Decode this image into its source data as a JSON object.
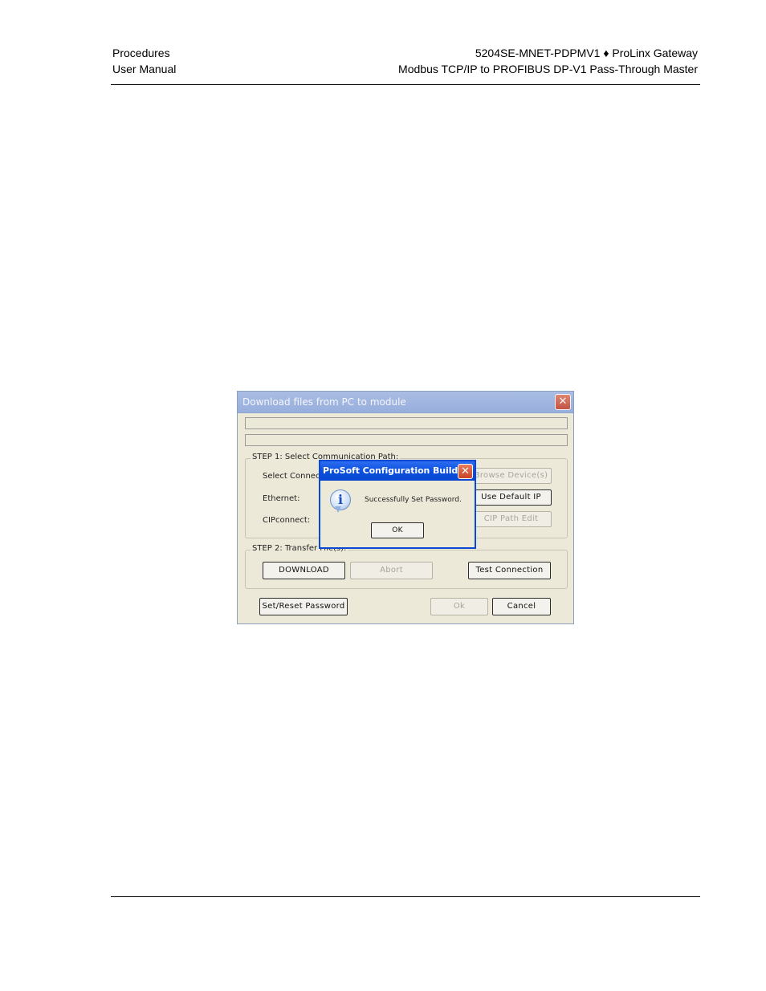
{
  "header": {
    "left_line1": "Procedures",
    "left_line2": "User Manual",
    "right_line1": "5204SE-MNET-PDPMV1 ♦ ProLinx Gateway",
    "right_line2": "Modbus TCP/IP to PROFIBUS DP-V1 Pass-Through Master"
  },
  "download_dialog": {
    "title": "Download files from PC to module",
    "step1_label": "STEP 1: Select Communication Path:",
    "select_connection_label": "Select Connection",
    "ethernet_label": "Ethernet:",
    "cipconnect_label": "CIPconnect:",
    "browse_button": "Browse Device(s)",
    "default_ip_button": "Use Default IP",
    "cip_path_button": "CIP Path Edit",
    "step2_label": "STEP 2: Transfer File(s):",
    "download_button": "DOWNLOAD",
    "abort_button": "Abort",
    "test_button": "Test Connection",
    "set_password_button": "Set/Reset Password",
    "ok_button": "Ok",
    "cancel_button": "Cancel"
  },
  "message_box": {
    "title": "ProSoft Configuration Builder",
    "message": "Successfully Set Password.",
    "ok_button": "OK",
    "icon": "info-icon"
  },
  "colors": {
    "dialog_bg": "#ece9d8",
    "active_title": "#0a4fe0",
    "inactive_title": "#a9bde4",
    "close_red": "#c9452a"
  }
}
